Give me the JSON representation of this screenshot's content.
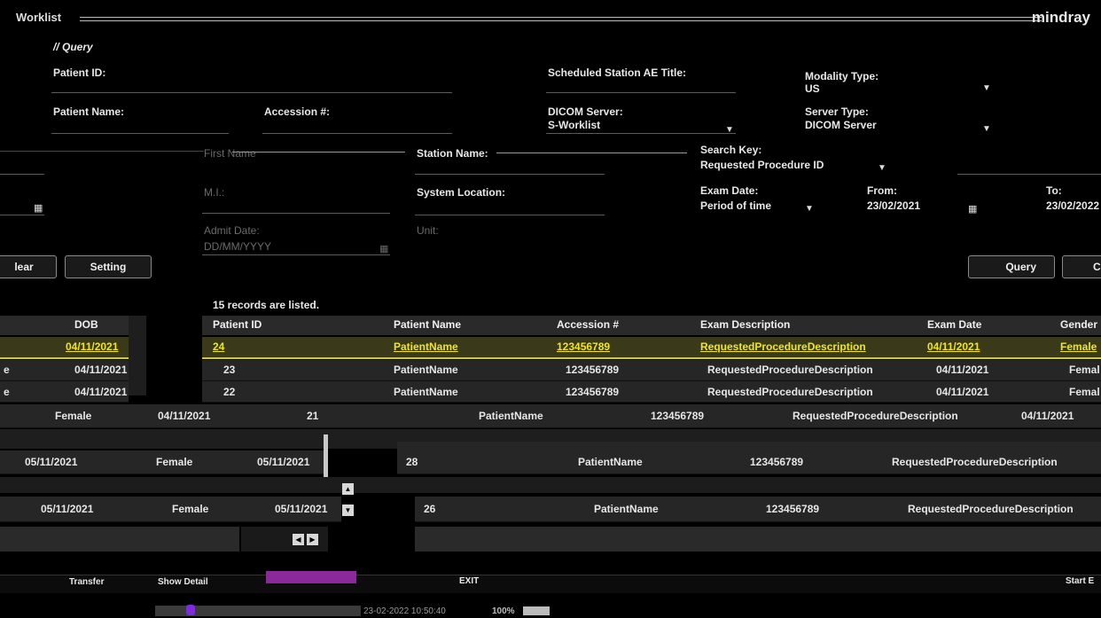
{
  "window": {
    "title": "Worklist",
    "brand": "mindray"
  },
  "query": {
    "section_label": "// Query",
    "patient_id_label": "Patient ID:",
    "patient_name_label": "Patient Name:",
    "accession_label": "Accession #:",
    "first_name_label": "First Name",
    "mi_label": "M.I.:",
    "admit_date_label": "Admit Date:",
    "admit_date_placeholder": "DD/MM/YYYY",
    "scheduled_station_label": "Scheduled Station AE Title:",
    "station_name_label": "Station Name:",
    "system_location_label": "System Location:",
    "unit_label": "Unit:",
    "dicom_server_label": "DICOM Server:",
    "dicom_server_value": "S-Worklist",
    "modality_label": "Modality Type:",
    "modality_value": "US",
    "server_type_label": "Server Type:",
    "server_type_value": "DICOM Server",
    "search_key_label": "Search Key:",
    "search_key_value": "Requested Procedure ID",
    "exam_date_label": "Exam Date:",
    "exam_date_value": "Period of time",
    "from_label": "From:",
    "from_value": "23/02/2021",
    "to_label": "To:",
    "to_value": "23/02/2022"
  },
  "buttons": {
    "clear": "lear",
    "setting": "Setting",
    "query": "Query",
    "cancel": "C"
  },
  "records_text": "15 records are listed.",
  "table": {
    "headers": {
      "dob": "DOB",
      "patient_id": "Patient ID",
      "patient_name": "Patient Name",
      "accession": "Accession #",
      "exam_description": "Exam Description",
      "exam_date": "Exam Date",
      "gender": "Gender"
    },
    "rows": [
      {
        "dob": "04/11/2021",
        "id": "24",
        "name": "PatientName",
        "acc": "123456789",
        "desc": "RequestedProcedureDescription",
        "date": "04/11/2021",
        "gender": "Female"
      },
      {
        "dob": "04/11/2021",
        "id": "23",
        "name": "PatientName",
        "acc": "123456789",
        "desc": "RequestedProcedureDescription",
        "date": "04/11/2021",
        "gender": "Femal"
      },
      {
        "dob": "04/11/2021",
        "id": "22",
        "name": "PatientName",
        "acc": "123456789",
        "desc": "RequestedProcedureDescription",
        "date": "04/11/2021",
        "gender": "Femal"
      },
      {
        "gender": "Female",
        "dob": "04/11/2021",
        "id": "21",
        "name": "PatientName",
        "acc": "123456789",
        "desc": "RequestedProcedureDescription",
        "date": "04/11/2021"
      },
      {
        "date": "05/11/2021",
        "gender": "Female",
        "dob": "05/11/2021",
        "id": "28",
        "name": "PatientName",
        "acc": "123456789",
        "desc": "RequestedProcedureDescription"
      },
      {
        "date": "05/11/2021",
        "gender": "Female",
        "dob": "05/11/2021",
        "id": "26",
        "name": "PatientName",
        "acc": "123456789",
        "desc": "RequestedProcedureDescription"
      }
    ],
    "row_prefix_e": "e"
  },
  "bottom": {
    "exit": "EXIT",
    "transfer": "Transfer",
    "show_detail": "Show Detail",
    "start": "Start E"
  },
  "taskbar": {
    "datetime": "23-02-2022 10:50:40",
    "zoom": "100%"
  }
}
